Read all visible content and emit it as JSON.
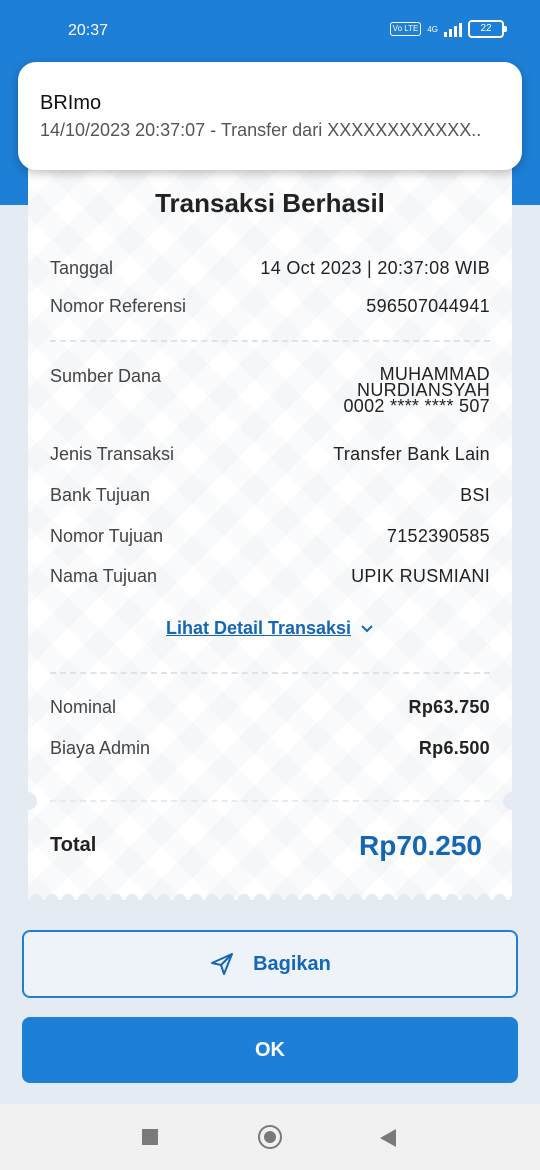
{
  "status_bar": {
    "time": "20:37",
    "volte": "Vo LTE",
    "network": "4G",
    "battery": "22"
  },
  "notification": {
    "app_name": "BRImo",
    "text": "14/10/2023 20:37:07 - Transfer dari XXXXXXXXXXXX.."
  },
  "receipt": {
    "title": "Transaksi Berhasil",
    "tanggal": {
      "label": "Tanggal",
      "value": "14 Oct 2023 | 20:37:08 WIB"
    },
    "nomor_referensi": {
      "label": "Nomor Referensi",
      "value": "596507044941"
    },
    "sumber_dana": {
      "label": "Sumber Dana",
      "line1": "MUHAMMAD",
      "line2": "NURDIANSYAH",
      "line3": "0002 **** **** 507"
    },
    "jenis_transaksi": {
      "label": "Jenis Transaksi",
      "value": "Transfer Bank Lain"
    },
    "bank_tujuan": {
      "label": "Bank Tujuan",
      "value": "BSI"
    },
    "nomor_tujuan": {
      "label": "Nomor Tujuan",
      "value": "7152390585"
    },
    "nama_tujuan": {
      "label": "Nama Tujuan",
      "value": "UPIK RUSMIANI"
    },
    "detail_link": "Lihat Detail Transaksi",
    "nominal": {
      "label": "Nominal",
      "value": "Rp63.750"
    },
    "biaya_admin": {
      "label": "Biaya Admin",
      "value": "Rp6.500"
    },
    "total": {
      "label": "Total",
      "value": "Rp70.250"
    }
  },
  "buttons": {
    "share": "Bagikan",
    "ok": "OK"
  },
  "colors": {
    "primary": "#1d7fd6",
    "link": "#1566b3",
    "background": "#e4ebf3"
  }
}
